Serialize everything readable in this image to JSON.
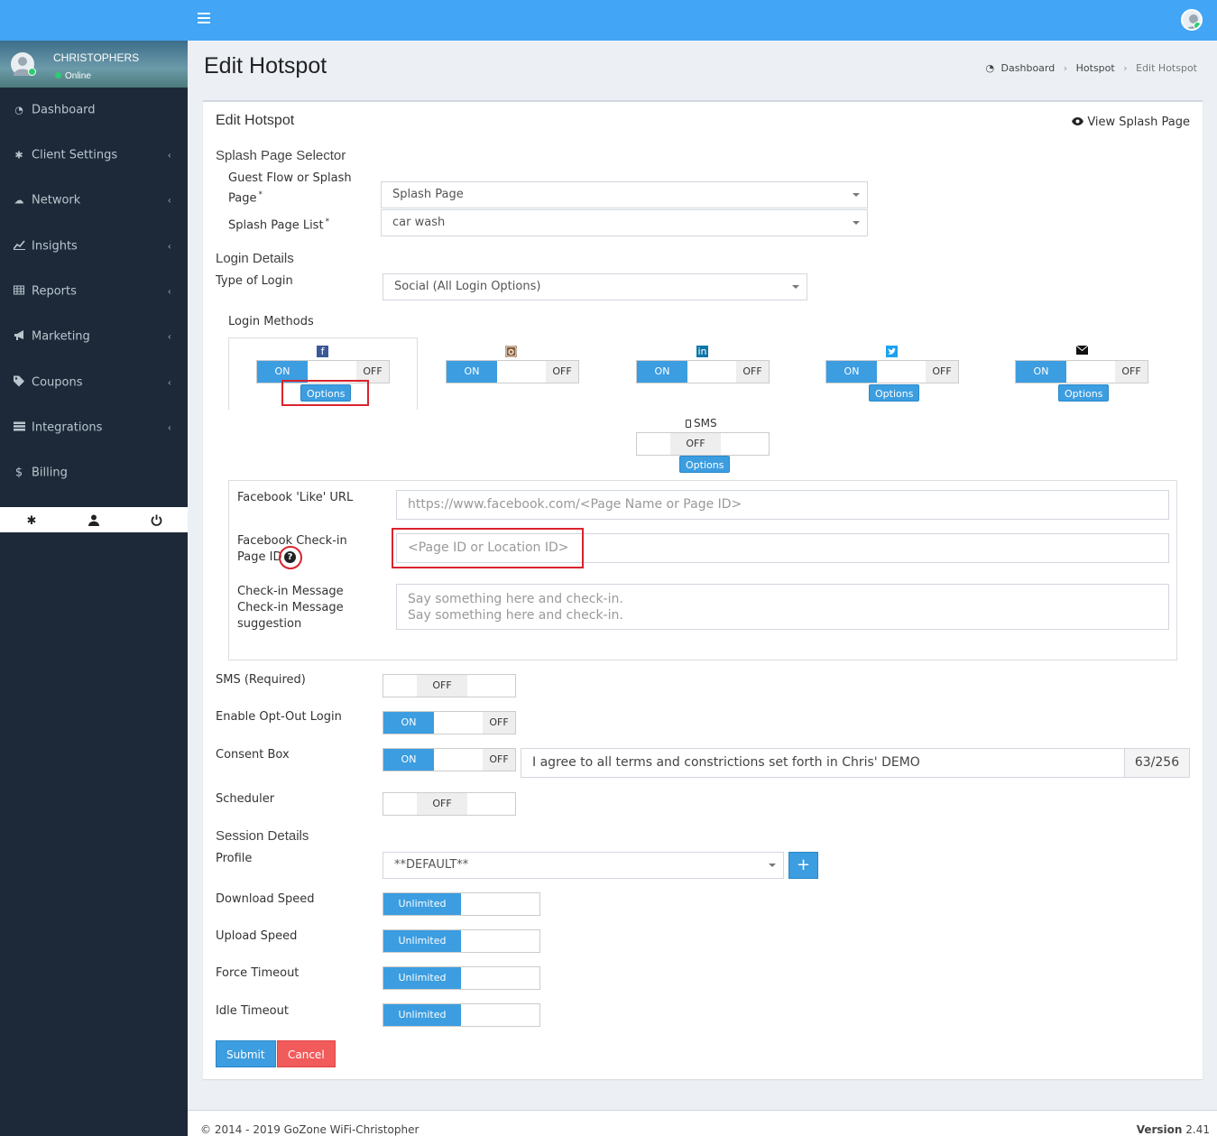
{
  "user": {
    "name": "CHRISTOPHERS",
    "status": "Online"
  },
  "sidebar": {
    "items": [
      {
        "label": "Dashboard",
        "icon": "dashboard-icon",
        "has_children": false
      },
      {
        "label": "Client Settings",
        "icon": "gear-icon",
        "has_children": true
      },
      {
        "label": "Network",
        "icon": "cloud-icon",
        "has_children": true
      },
      {
        "label": "Insights",
        "icon": "line-chart-icon",
        "has_children": true
      },
      {
        "label": "Reports",
        "icon": "table-icon",
        "has_children": true
      },
      {
        "label": "Marketing",
        "icon": "bullhorn-icon",
        "has_children": true
      },
      {
        "label": "Coupons",
        "icon": "tag-icon",
        "has_children": true
      },
      {
        "label": "Integrations",
        "icon": "server-icon",
        "has_children": true
      },
      {
        "label": "Billing",
        "icon": "dollar-icon",
        "has_children": false
      }
    ],
    "footer_icons": [
      "gear-icon",
      "user-icon",
      "power-icon"
    ]
  },
  "page": {
    "title": "Edit Hotspot"
  },
  "breadcrumb": {
    "home": "Dashboard",
    "parent": "Hotspot",
    "current": "Edit Hotspot"
  },
  "box": {
    "title": "Edit Hotspot",
    "view_splash": "View Splash Page"
  },
  "splash": {
    "section": "Splash Page Selector",
    "guest_flow_label": "Guest Flow or Splash Page",
    "guest_flow_value": "Splash Page",
    "list_label": "Splash Page List",
    "list_value": "car wash",
    "required_mark": "*"
  },
  "login": {
    "section": "Login Details",
    "type_label": "Type of Login",
    "type_value": "Social (All Login Options)",
    "methods_label": "Login Methods",
    "on_label": "ON",
    "off_label": "OFF",
    "options_label": "Options",
    "sms_label": "SMS",
    "methods": [
      {
        "name": "facebook",
        "state": "on",
        "options": true
      },
      {
        "name": "instagram",
        "state": "on",
        "options": false
      },
      {
        "name": "linkedin",
        "state": "on",
        "options": false
      },
      {
        "name": "twitter",
        "state": "on",
        "options": true
      },
      {
        "name": "email",
        "state": "on",
        "options": true
      },
      {
        "name": "sms",
        "state": "off",
        "options": true
      }
    ]
  },
  "facebook_options": {
    "like_url_label": "Facebook 'Like' URL",
    "like_url_placeholder": "https://www.facebook.com/<Page Name or Page ID>",
    "checkin_label": "Facebook Check-in Page ID",
    "checkin_placeholder": "<Page ID or Location ID>",
    "message_label": "Check-in Message",
    "message_label_overlap": "Check-in Message suggestion",
    "message_placeholder": "Say something here and check-in.",
    "message_placeholder_overlap": "Say something here and check-in."
  },
  "settings": {
    "sms_required_label": "SMS (Required)",
    "sms_required_state": "OFF",
    "opt_out_label": "Enable Opt-Out Login",
    "consent_label": "Consent Box",
    "consent_text": "I agree to all terms and constrictions set forth in Chris' DEMO",
    "consent_count": "63/256",
    "scheduler_label": "Scheduler",
    "scheduler_state": "OFF"
  },
  "session": {
    "section": "Session Details",
    "profile_label": "Profile",
    "profile_value": "**DEFAULT**",
    "unlimited": "Unlimited",
    "download_label": "Download Speed",
    "upload_label": "Upload Speed",
    "force_label": "Force Timeout",
    "idle_label": "Idle Timeout"
  },
  "actions": {
    "submit": "Submit",
    "cancel": "Cancel"
  },
  "footer": {
    "copyright": "© 2014 - 2019 GoZone WiFi-Christopher",
    "version_label": "Version",
    "version": "2.41"
  },
  "colors": {
    "topbar": "#42a5f5",
    "sidebar": "#1d2939",
    "accent": "#3c9de0",
    "danger": "#f15b5b",
    "highlight": "#d9232d"
  }
}
